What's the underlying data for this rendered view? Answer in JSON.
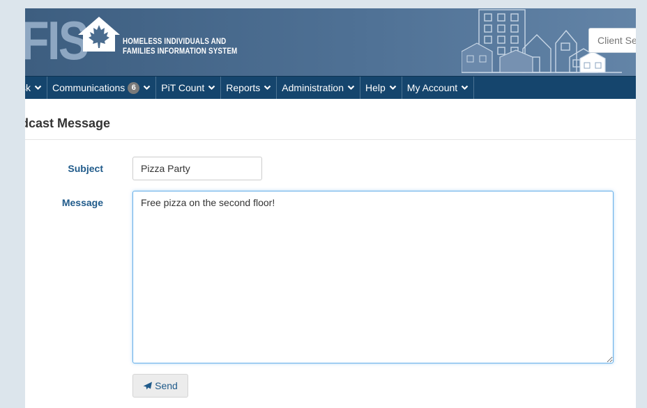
{
  "header": {
    "logo_letters": "FIS",
    "logo_line1": "HOMELESS INDIVIDUALS AND",
    "logo_line2": "FAMILIES INFORMATION SYSTEM",
    "client_search_placeholder": "Client Search"
  },
  "nav": {
    "items": [
      {
        "label": "sk",
        "icon": "chevron-down-icon"
      },
      {
        "label": "Communications",
        "badge": "6",
        "icon": "chevron-down-icon"
      },
      {
        "label": "PiT Count",
        "icon": "chevron-down-icon"
      },
      {
        "label": "Reports",
        "icon": "chevron-down-icon"
      },
      {
        "label": "Administration",
        "icon": "chevron-down-icon"
      },
      {
        "label": "Help",
        "icon": "chevron-down-icon"
      },
      {
        "label": "My Account",
        "icon": "chevron-down-icon"
      }
    ]
  },
  "page": {
    "title": "dcast Message"
  },
  "form": {
    "subject_label": "Subject",
    "subject_value": "Pizza Party",
    "message_label": "Message",
    "message_value": "Free pizza on the second floor!",
    "send_label": "Send",
    "send_icon": "paper-plane-icon"
  },
  "colors": {
    "header_bg": "#4f7195",
    "nav_bg": "#15456d",
    "label_color": "#1f5a8a",
    "page_bg": "#dce5ec"
  }
}
